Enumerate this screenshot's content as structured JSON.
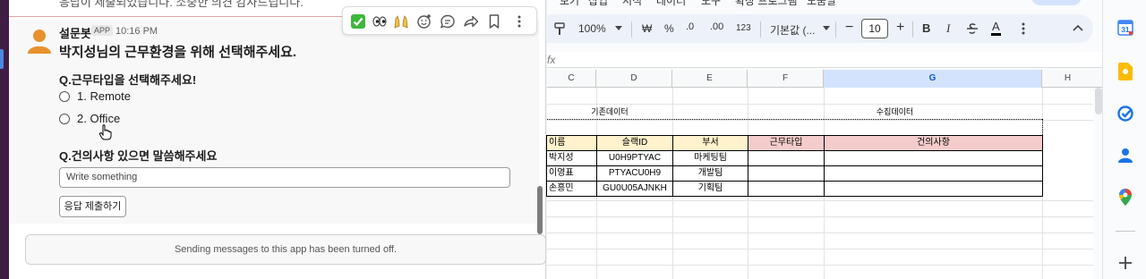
{
  "slack": {
    "previous_text": "응답이 제출되었습니다. 소중한 의견 감사드립니다.",
    "sender": "설문봇",
    "app_badge": "APP",
    "time": "10:16 PM",
    "headline": "박지성님의 근무환경을 위해 선택해주세요.",
    "question1": "Q.근무타입을 선택해주세요!",
    "options": [
      "1. Remote",
      "2. Office"
    ],
    "question2": "Q.건의사항 있으면 말씀해주세요",
    "input_placeholder": "Write something",
    "submit_label": "응답 제출하기",
    "disabled_notice": "Sending messages to this app has been turned off.",
    "toolbar_icons": [
      "check-reaction-icon",
      "eyes-reaction-icon",
      "raised-hands-reaction-icon",
      "add-reaction-icon",
      "reply-thread-icon",
      "share-icon",
      "bookmark-icon",
      "more-actions-icon"
    ]
  },
  "sheets": {
    "menu": [
      "보기",
      "삽입",
      "서식",
      "데이터",
      "도구",
      "확장 프로그램",
      "도움말"
    ],
    "toolbar": {
      "zoom": "100%",
      "currency": "₩",
      "percent": "%",
      "dec_decrease": ".0",
      "dec_increase": ".00",
      "number_format": "123",
      "font": "기본값 (...",
      "font_size": "10",
      "bold": "B",
      "italic": "I",
      "underline_text": "A"
    },
    "fx": "fx",
    "columns": [
      "C",
      "D",
      "E",
      "F",
      "G",
      "H"
    ],
    "group_labels": {
      "existing": "기존데이터",
      "collected": "수집데이터"
    },
    "table_headers": [
      "이름",
      "슬랙ID",
      "부서",
      "근무타입",
      "건의사항"
    ],
    "rows": [
      [
        "박지성",
        "U0H9PTYAC",
        "마케팅팀",
        "",
        ""
      ],
      [
        "이영표",
        "PTYACU0H9",
        "개발팀",
        "",
        ""
      ],
      [
        "손흥민",
        "GU0U05AJNKH",
        "기획팀",
        "",
        ""
      ]
    ]
  },
  "colors": {
    "header_yellow": "#fff2cc",
    "header_pink": "#f4cccc",
    "selected_col": "#d3e3fd",
    "slack_aubergine": "#3f1d45"
  },
  "side_panel": [
    "calendar-icon",
    "keep-icon",
    "tasks-icon",
    "contacts-icon",
    "maps-icon",
    "add-icon"
  ]
}
